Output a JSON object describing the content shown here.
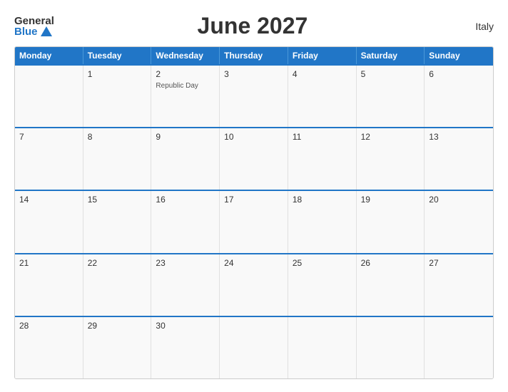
{
  "header": {
    "logo_general": "General",
    "logo_blue": "Blue",
    "title": "June 2027",
    "country": "Italy"
  },
  "weekdays": [
    "Monday",
    "Tuesday",
    "Wednesday",
    "Thursday",
    "Friday",
    "Saturday",
    "Sunday"
  ],
  "weeks": [
    [
      {
        "day": "",
        "holiday": ""
      },
      {
        "day": "1",
        "holiday": ""
      },
      {
        "day": "2",
        "holiday": "Republic Day"
      },
      {
        "day": "3",
        "holiday": ""
      },
      {
        "day": "4",
        "holiday": ""
      },
      {
        "day": "5",
        "holiday": ""
      },
      {
        "day": "6",
        "holiday": ""
      }
    ],
    [
      {
        "day": "7",
        "holiday": ""
      },
      {
        "day": "8",
        "holiday": ""
      },
      {
        "day": "9",
        "holiday": ""
      },
      {
        "day": "10",
        "holiday": ""
      },
      {
        "day": "11",
        "holiday": ""
      },
      {
        "day": "12",
        "holiday": ""
      },
      {
        "day": "13",
        "holiday": ""
      }
    ],
    [
      {
        "day": "14",
        "holiday": ""
      },
      {
        "day": "15",
        "holiday": ""
      },
      {
        "day": "16",
        "holiday": ""
      },
      {
        "day": "17",
        "holiday": ""
      },
      {
        "day": "18",
        "holiday": ""
      },
      {
        "day": "19",
        "holiday": ""
      },
      {
        "day": "20",
        "holiday": ""
      }
    ],
    [
      {
        "day": "21",
        "holiday": ""
      },
      {
        "day": "22",
        "holiday": ""
      },
      {
        "day": "23",
        "holiday": ""
      },
      {
        "day": "24",
        "holiday": ""
      },
      {
        "day": "25",
        "holiday": ""
      },
      {
        "day": "26",
        "holiday": ""
      },
      {
        "day": "27",
        "holiday": ""
      }
    ],
    [
      {
        "day": "28",
        "holiday": ""
      },
      {
        "day": "29",
        "holiday": ""
      },
      {
        "day": "30",
        "holiday": ""
      },
      {
        "day": "",
        "holiday": ""
      },
      {
        "day": "",
        "holiday": ""
      },
      {
        "day": "",
        "holiday": ""
      },
      {
        "day": "",
        "holiday": ""
      }
    ]
  ],
  "colors": {
    "header_bg": "#2176c7",
    "border_accent": "#2176c7"
  }
}
